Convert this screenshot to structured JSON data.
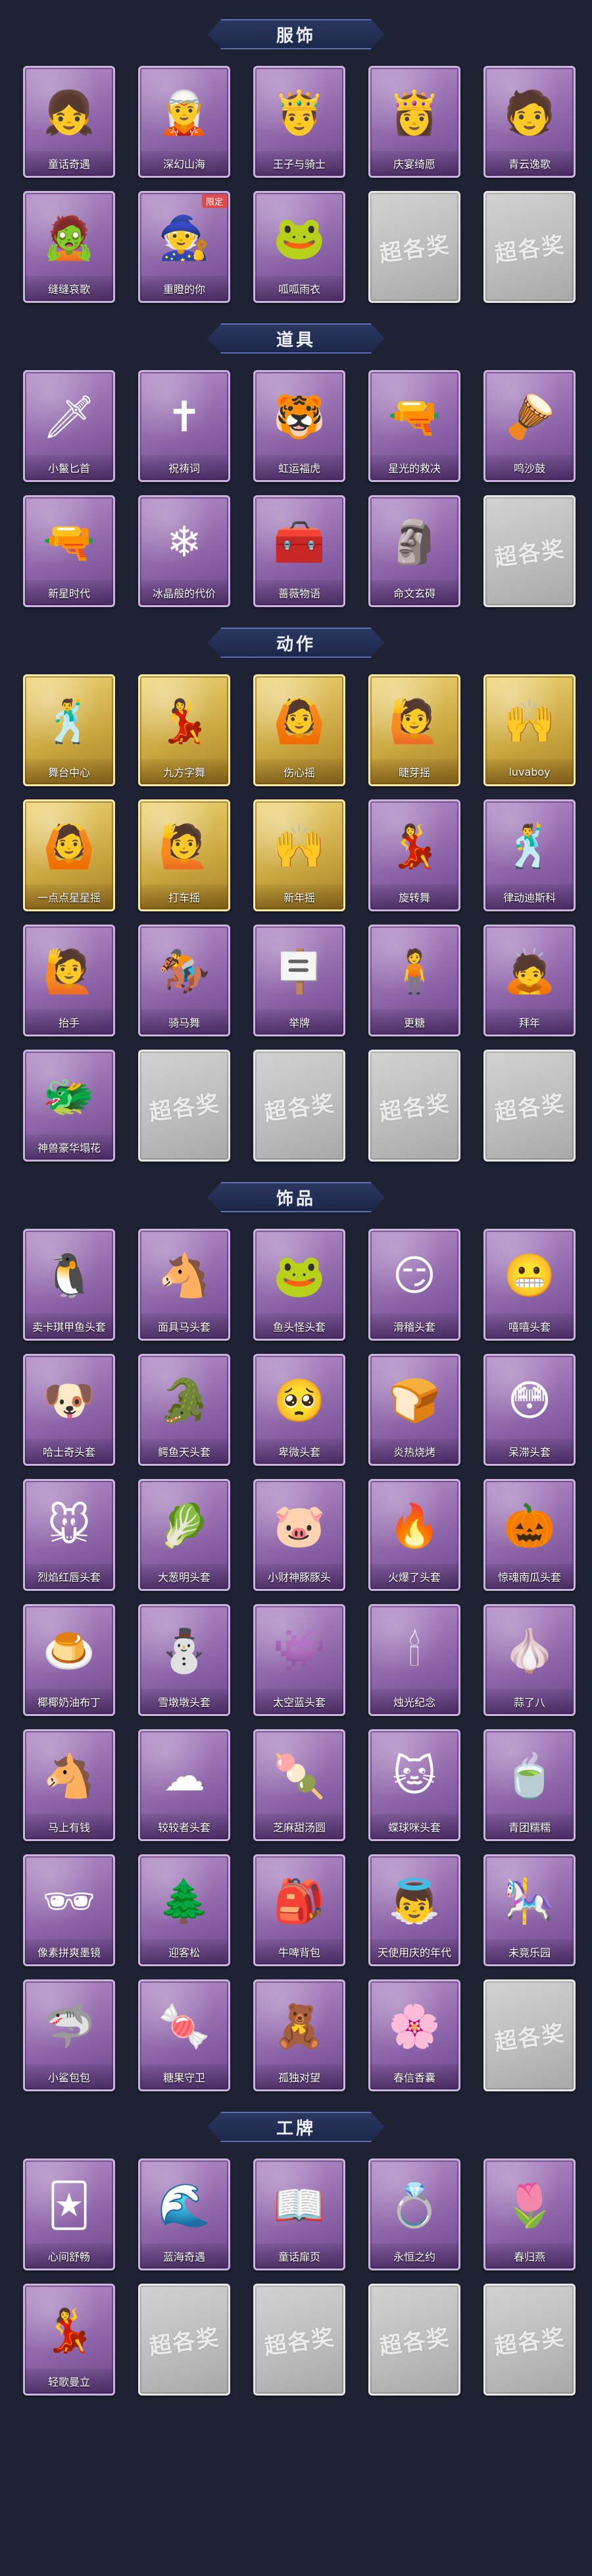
{
  "watermark_text": "超各奖",
  "sections": [
    {
      "title": "服饰",
      "items": [
        {
          "label": "童话奇遇",
          "icon": "👧",
          "style": "normal"
        },
        {
          "label": "深幻山海",
          "icon": "🧝",
          "style": "normal"
        },
        {
          "label": "王子与骑士",
          "icon": "🤴",
          "style": "normal"
        },
        {
          "label": "庆宴绮愿",
          "icon": "👸",
          "style": "normal"
        },
        {
          "label": "青云逸歌",
          "icon": "🧑",
          "style": "normal"
        },
        {
          "label": "缝缝哀歌",
          "icon": "🧟",
          "style": "normal"
        },
        {
          "label": "重瞪的你",
          "icon": "🧙",
          "style": "normal",
          "tag": "限定"
        },
        {
          "label": "呱呱雨衣",
          "icon": "🐸",
          "style": "normal"
        },
        {
          "label": "",
          "icon": "",
          "style": "empty"
        },
        {
          "label": "",
          "icon": "",
          "style": "empty"
        }
      ]
    },
    {
      "title": "道具",
      "items": [
        {
          "label": "小鬣匕首",
          "icon": "🗡",
          "style": "normal"
        },
        {
          "label": "祝祷词",
          "icon": "✝",
          "style": "normal"
        },
        {
          "label": "虹运福虎",
          "icon": "🐯",
          "style": "normal"
        },
        {
          "label": "星光的救决",
          "icon": "🔫",
          "style": "normal"
        },
        {
          "label": "鸣沙鼓",
          "icon": "🪘",
          "style": "normal"
        },
        {
          "label": "新星时代",
          "icon": "🔫",
          "style": "normal"
        },
        {
          "label": "冰晶般的代价",
          "icon": "❄",
          "style": "normal"
        },
        {
          "label": "蔷薇物语",
          "icon": "🧰",
          "style": "normal"
        },
        {
          "label": "命文玄碍",
          "icon": "🗿",
          "style": "normal"
        },
        {
          "label": "",
          "icon": "",
          "style": "empty"
        }
      ]
    },
    {
      "title": "动作",
      "items": [
        {
          "label": "舞台中心",
          "icon": "🕺",
          "style": "gold"
        },
        {
          "label": "九方字舞",
          "icon": "💃",
          "style": "gold"
        },
        {
          "label": "伤心摇",
          "icon": "🙆",
          "style": "gold"
        },
        {
          "label": "睫芽摇",
          "icon": "🙋",
          "style": "gold"
        },
        {
          "label": "luvaboy",
          "icon": "🙌",
          "style": "gold"
        },
        {
          "label": "一点点星星摇",
          "icon": "🙆",
          "style": "gold"
        },
        {
          "label": "打车摇",
          "icon": "🙋",
          "style": "gold"
        },
        {
          "label": "新年摇",
          "icon": "🙌",
          "style": "gold"
        },
        {
          "label": "旋转舞",
          "icon": "💃",
          "style": "normal"
        },
        {
          "label": "律动迪斯科",
          "icon": "🕺",
          "style": "normal"
        },
        {
          "label": "抬手",
          "icon": "🙋",
          "style": "normal"
        },
        {
          "label": "骑马舞",
          "icon": "🏇",
          "style": "normal"
        },
        {
          "label": "举牌",
          "icon": "🪧",
          "style": "normal"
        },
        {
          "label": "更糖",
          "icon": "🧍",
          "style": "normal"
        },
        {
          "label": "拜年",
          "icon": "🙇",
          "style": "normal"
        },
        {
          "label": "神兽豪华塌花",
          "icon": "🐲",
          "style": "normal"
        },
        {
          "label": "",
          "icon": "",
          "style": "empty"
        },
        {
          "label": "",
          "icon": "",
          "style": "empty"
        },
        {
          "label": "",
          "icon": "",
          "style": "empty"
        },
        {
          "label": "",
          "icon": "",
          "style": "empty"
        }
      ]
    },
    {
      "title": "饰品",
      "items": [
        {
          "label": "卖卡琪甲鱼头套",
          "icon": "🐧",
          "style": "normal"
        },
        {
          "label": "面具马头套",
          "icon": "🐴",
          "style": "normal"
        },
        {
          "label": "鱼头怪头套",
          "icon": "🐸",
          "style": "normal"
        },
        {
          "label": "滑稽头套",
          "icon": "😏",
          "style": "normal"
        },
        {
          "label": "嘻嘻头套",
          "icon": "😬",
          "style": "normal"
        },
        {
          "label": "哈士奇头套",
          "icon": "🐶",
          "style": "normal"
        },
        {
          "label": "鳄鱼天头套",
          "icon": "🐊",
          "style": "normal"
        },
        {
          "label": "卑微头套",
          "icon": "🥺",
          "style": "normal"
        },
        {
          "label": "炎热烧烤",
          "icon": "🍞",
          "style": "normal"
        },
        {
          "label": "呆滞头套",
          "icon": "😳",
          "style": "normal"
        },
        {
          "label": "烈焰红唇头套",
          "icon": "🐭",
          "style": "normal"
        },
        {
          "label": "大葱明头套",
          "icon": "🥬",
          "style": "normal"
        },
        {
          "label": "小财神豚豚头",
          "icon": "🐷",
          "style": "normal"
        },
        {
          "label": "火爆了头套",
          "icon": "🔥",
          "style": "normal"
        },
        {
          "label": "惊魂南瓜头套",
          "icon": "🎃",
          "style": "normal"
        },
        {
          "label": "椰椰奶油布丁",
          "icon": "🍮",
          "style": "normal"
        },
        {
          "label": "雪墩墩头套",
          "icon": "⛄",
          "style": "normal"
        },
        {
          "label": "太空蓝头套",
          "icon": "👾",
          "style": "normal"
        },
        {
          "label": "烛光纪念",
          "icon": "🕯",
          "style": "normal"
        },
        {
          "label": "蒜了八",
          "icon": "🧄",
          "style": "normal"
        },
        {
          "label": "马上有钱",
          "icon": "🐴",
          "style": "normal"
        },
        {
          "label": "较较者头套",
          "icon": "☁",
          "style": "normal"
        },
        {
          "label": "芝麻甜汤圆",
          "icon": "🍡",
          "style": "normal"
        },
        {
          "label": "蝶球咪头套",
          "icon": "🐱",
          "style": "normal"
        },
        {
          "label": "青团糯糯",
          "icon": "🍵",
          "style": "normal"
        },
        {
          "label": "像素拼爽墨镜",
          "icon": "🕶",
          "style": "normal"
        },
        {
          "label": "迎客松",
          "icon": "🌲",
          "style": "normal"
        },
        {
          "label": "牛啤背包",
          "icon": "🎒",
          "style": "normal"
        },
        {
          "label": "天使用庆的年代",
          "icon": "👼",
          "style": "normal"
        },
        {
          "label": "未竟乐园",
          "icon": "🎠",
          "style": "normal"
        },
        {
          "label": "小鲨包包",
          "icon": "🦈",
          "style": "normal"
        },
        {
          "label": "糖果守卫",
          "icon": "🍬",
          "style": "normal"
        },
        {
          "label": "孤独对望",
          "icon": "🧸",
          "style": "normal"
        },
        {
          "label": "春信香囊",
          "icon": "🌸",
          "style": "normal"
        },
        {
          "label": "",
          "icon": "",
          "style": "empty"
        }
      ]
    },
    {
      "title": "工牌",
      "items": [
        {
          "label": "心间舒畅",
          "icon": "🃏",
          "style": "normal"
        },
        {
          "label": "蓝海奇遇",
          "icon": "🌊",
          "style": "normal"
        },
        {
          "label": "童话扉页",
          "icon": "📖",
          "style": "normal"
        },
        {
          "label": "永恒之约",
          "icon": "💍",
          "style": "normal"
        },
        {
          "label": "春归燕",
          "icon": "🌷",
          "style": "normal"
        },
        {
          "label": "轻歌曼立",
          "icon": "💃",
          "style": "normal"
        },
        {
          "label": "",
          "icon": "",
          "style": "empty"
        },
        {
          "label": "",
          "icon": "",
          "style": "empty"
        },
        {
          "label": "",
          "icon": "",
          "style": "empty"
        },
        {
          "label": "",
          "icon": "",
          "style": "empty"
        }
      ]
    }
  ]
}
